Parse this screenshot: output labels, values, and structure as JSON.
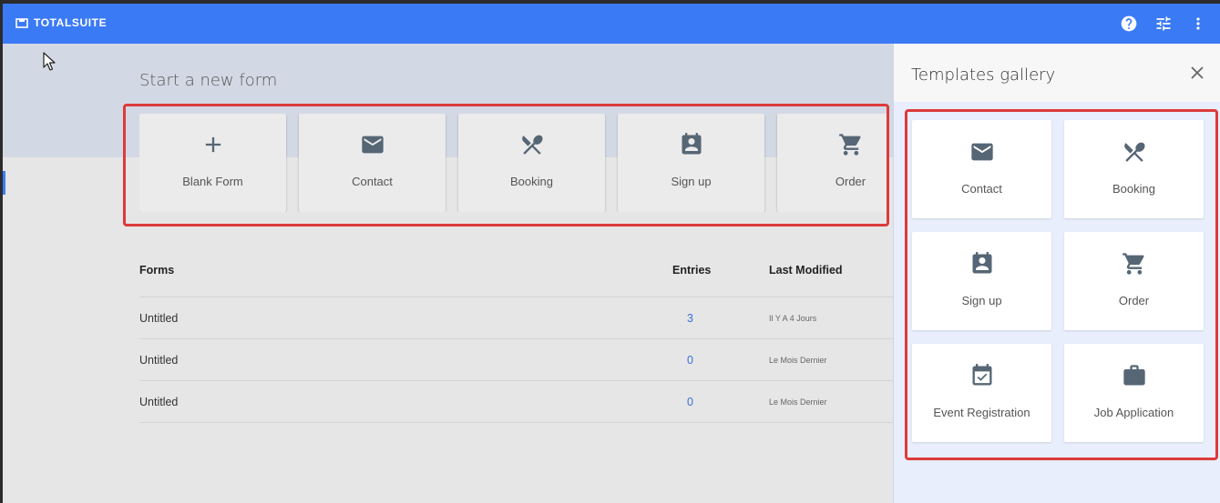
{
  "brand": {
    "name": "TOTALSUITE"
  },
  "topbar": {
    "icons": [
      "help-icon",
      "tune-icon",
      "more-vert-icon"
    ]
  },
  "hero": {
    "title": "Start a new form"
  },
  "start_cards": [
    {
      "label": "Blank Form",
      "icon": "plus-icon"
    },
    {
      "label": "Contact",
      "icon": "mail-icon"
    },
    {
      "label": "Booking",
      "icon": "restaurant-icon"
    },
    {
      "label": "Sign up",
      "icon": "contact-card-icon"
    },
    {
      "label": "Order",
      "icon": "cart-icon"
    }
  ],
  "table": {
    "headers": {
      "forms": "Forms",
      "entries": "Entries",
      "modified": "Last Modified"
    },
    "rows": [
      {
        "name": "Untitled",
        "entries": "3",
        "modified": "Il Y A 4 Jours"
      },
      {
        "name": "Untitled",
        "entries": "0",
        "modified": "Le Mois Dernier"
      },
      {
        "name": "Untitled",
        "entries": "0",
        "modified": "Le Mois Dernier"
      }
    ]
  },
  "gallery": {
    "title": "Templates gallery",
    "items": [
      {
        "label": "Contact",
        "icon": "mail-icon"
      },
      {
        "label": "Booking",
        "icon": "restaurant-icon"
      },
      {
        "label": "Sign up",
        "icon": "contact-card-icon"
      },
      {
        "label": "Order",
        "icon": "cart-icon"
      },
      {
        "label": "Event Registration",
        "icon": "event-check-icon"
      },
      {
        "label": "Job Application",
        "icon": "briefcase-icon"
      }
    ]
  },
  "colors": {
    "accent": "#3b7af5",
    "highlight": "#dc3b3b",
    "icon": "#566675",
    "link": "#3b6fe0"
  }
}
